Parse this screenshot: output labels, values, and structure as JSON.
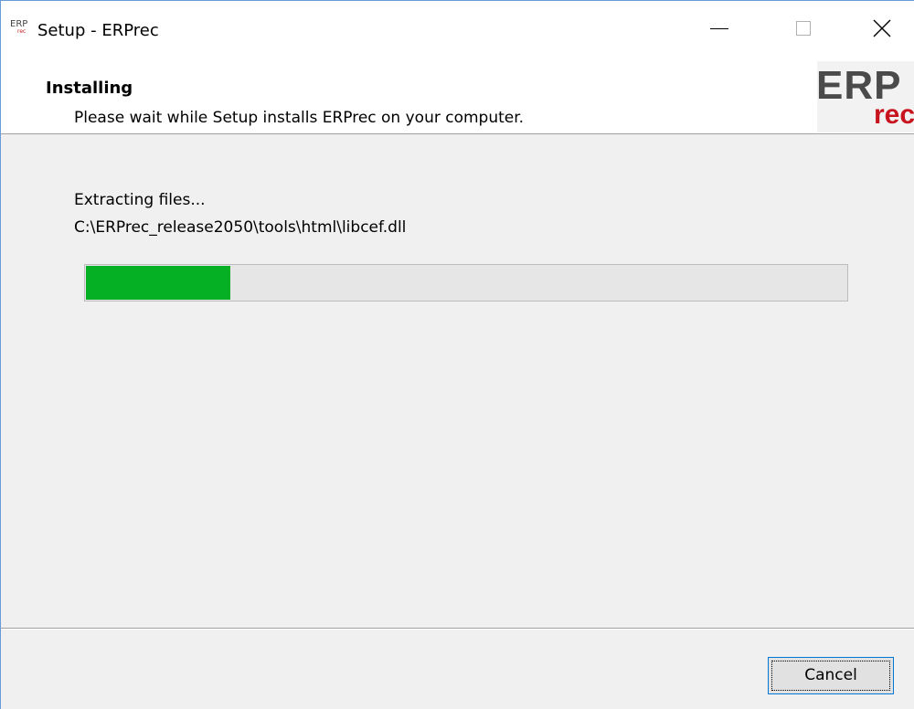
{
  "window": {
    "title": "Setup - ERPrec",
    "icon": {
      "top": "ERP",
      "bottom": "rec"
    }
  },
  "header": {
    "title": "Installing",
    "subtitle": "Please wait while Setup installs ERPrec on your computer.",
    "logo": {
      "line1": "ERP",
      "line2": "rec",
      "colors": {
        "erp": "#4a4a4a",
        "rec": "#c8141e"
      }
    }
  },
  "body": {
    "status": "Extracting files...",
    "current_file": "C:\\ERPrec_release2050\\tools\\html\\libcef.dll",
    "progress": {
      "fraction": 0.19,
      "color": "#06b025"
    }
  },
  "footer": {
    "cancel_label": "Cancel"
  }
}
